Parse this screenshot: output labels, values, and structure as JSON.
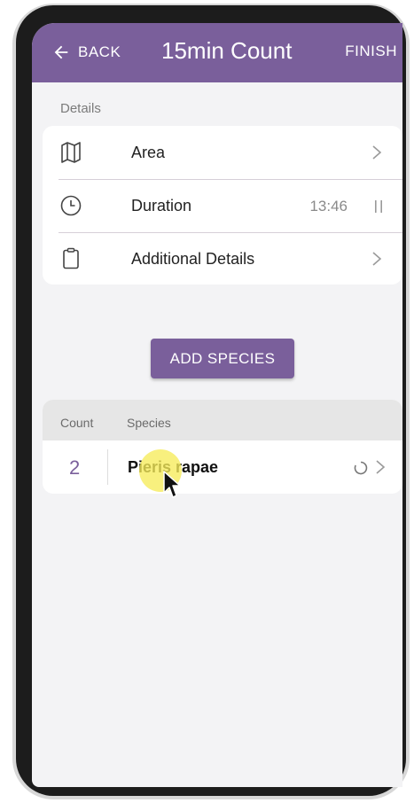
{
  "header": {
    "back_label": "BACK",
    "title": "15min Count",
    "finish_label": "FINISH"
  },
  "details": {
    "section_label": "Details",
    "rows": [
      {
        "label": "Area",
        "icon": "map-icon"
      },
      {
        "label": "Duration",
        "value": "13:46",
        "icon": "clock-icon"
      },
      {
        "label": "Additional Details",
        "icon": "clipboard-icon"
      }
    ]
  },
  "add_species_label": "ADD SPECIES",
  "species_list": {
    "headers": {
      "count": "Count",
      "species": "Species"
    },
    "rows": [
      {
        "count": "2",
        "species": "Pieris rapae"
      }
    ]
  },
  "colors": {
    "accent": "#7a5f9b",
    "background": "#f3f3f5",
    "highlight": "#f6ec5a"
  }
}
